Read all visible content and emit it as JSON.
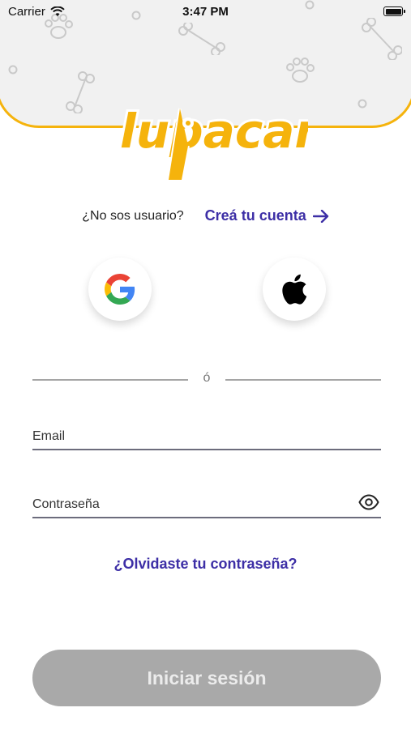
{
  "status_bar": {
    "carrier": "Carrier",
    "time": "3:47 PM"
  },
  "brand": {
    "logo_text": "lupacan",
    "color": "#f5b30c"
  },
  "signup": {
    "question": "¿No sos usuario?",
    "link_label": "Creá tu cuenta"
  },
  "social": {
    "google_icon": "google-g-icon",
    "apple_icon": "apple-icon"
  },
  "divider_label": "ó",
  "form": {
    "email_placeholder": "Email",
    "password_placeholder": "Contraseña",
    "forgot_label": "¿Olvidaste tu contraseña?"
  },
  "login_button": "Iniciar sesión",
  "colors": {
    "link": "#3d2fa6",
    "button_disabled": "#a9a9a9",
    "header_bg": "#f1f1f1"
  }
}
